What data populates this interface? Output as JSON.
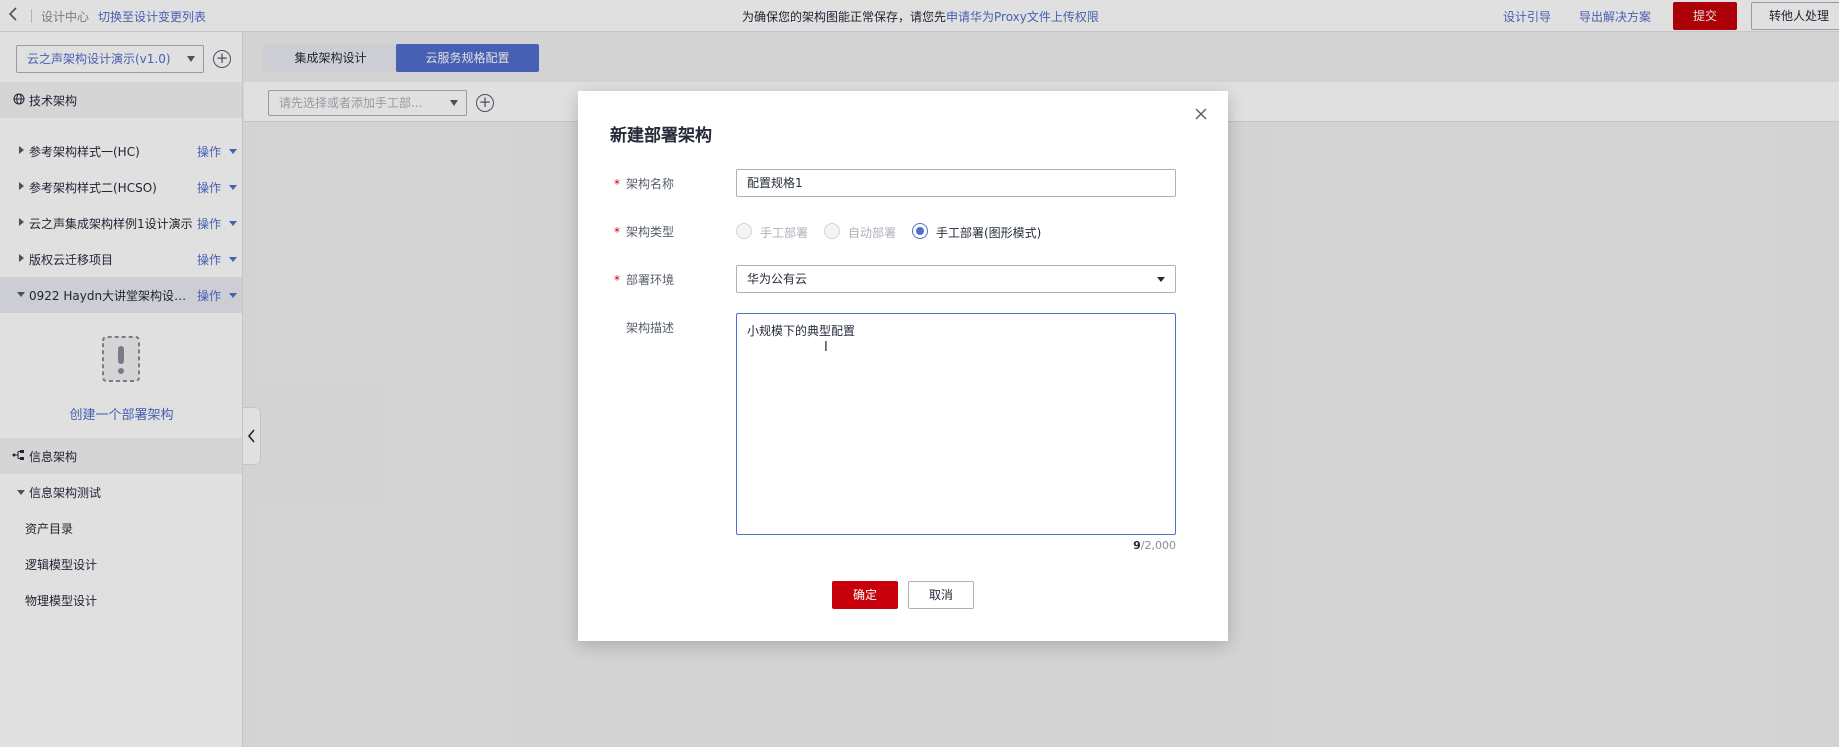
{
  "topbar": {
    "breadcrumb": "设计中心",
    "switch_link": "切换至设计变更列表",
    "notice_prefix": "为确保您的架构图能正常保存，请您先",
    "notice_link": "申请华为Proxy文件上传权限",
    "design_guide": "设计引导",
    "export_solution": "导出解决方案",
    "submit": "提交",
    "transfer": "转他人处理"
  },
  "sidebar": {
    "version_select": "云之声架构设计演示(v1.0)",
    "tech_arch_label": "技术架构",
    "arch_items": [
      {
        "label": "参考架构样式一(HC)",
        "op": "操作"
      },
      {
        "label": "参考架构样式二(HCSO)",
        "op": "操作"
      },
      {
        "label": "云之声集成架构样例1设计演示",
        "op": "操作"
      },
      {
        "label": "版权云迁移项目",
        "op": "操作"
      },
      {
        "label": "0922 Haydn大讲堂架构设计...",
        "op": "操作"
      }
    ],
    "create_deploy": "创建一个部署架构",
    "info_arch_label": "信息架构",
    "info_test_label": "信息架构测试",
    "sub_items": [
      "资产目录",
      "逻辑模型设计",
      "物理模型设计"
    ]
  },
  "main": {
    "tabs": [
      "集成架构设计",
      "云服务规格配置"
    ],
    "config_placeholder": "请先选择或者添加手工部..."
  },
  "modal": {
    "title": "新建部署架构",
    "name_label": "架构名称",
    "name_value": "配置规格1",
    "type_label": "架构类型",
    "type_options": [
      "手工部署",
      "自动部署",
      "手工部署(图形模式)"
    ],
    "env_label": "部署环境",
    "env_value": "华为公有云",
    "desc_label": "架构描述",
    "desc_value": "小规模下的典型配置",
    "counter_current": "9",
    "counter_max": "/2,000",
    "ok": "确定",
    "cancel": "取消"
  },
  "colors": {
    "accent": "#526ecc",
    "brand_red": "#c7000b"
  }
}
